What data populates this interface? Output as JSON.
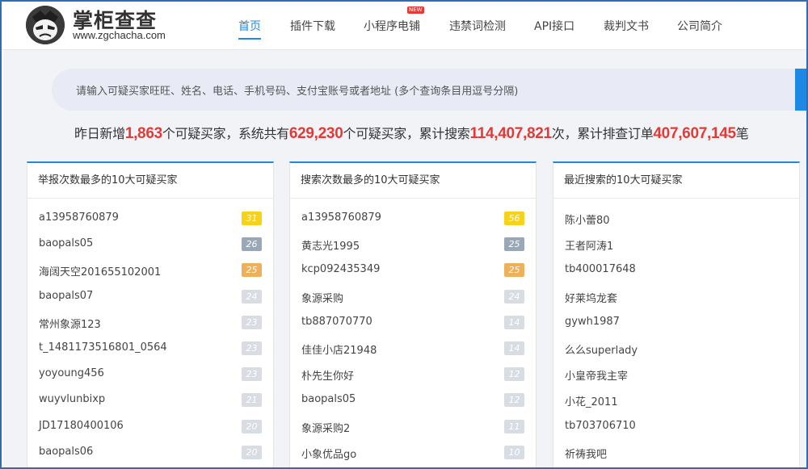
{
  "header": {
    "brand_name": "掌柜查查",
    "brand_url": "www.zgchacha.com",
    "logo_icon": "mascot-face-icon",
    "nav": [
      {
        "label": "首页",
        "active": true
      },
      {
        "label": "插件下载",
        "active": false
      },
      {
        "label": "小程序电铺",
        "active": false,
        "badge": "NEW"
      },
      {
        "label": "违禁词检测",
        "active": false
      },
      {
        "label": "API接口",
        "active": false
      },
      {
        "label": "裁判文书",
        "active": false
      },
      {
        "label": "公司简介",
        "active": false
      }
    ]
  },
  "search": {
    "placeholder": "请输入可疑买家旺旺、姓名、电话、手机号码、支付宝账号或者地址 (多个查询条目用逗号分隔)"
  },
  "stats": {
    "t1": "昨日新增",
    "n1": "1,863",
    "t2": "个可疑买家，系统共有",
    "n2": "629,230",
    "t3": "个可疑买家，累计搜索",
    "n3": "114,407,821",
    "t4": "次，累计排查订单",
    "n4": "407,607,145",
    "t5": "笔"
  },
  "panels": [
    {
      "title": "举报次数最多的10大可疑买家",
      "rows": [
        {
          "name": "a13958760879",
          "count": "31"
        },
        {
          "name": "baopals05",
          "count": "26"
        },
        {
          "name": "海阔天空201655102001",
          "count": "25"
        },
        {
          "name": "baopals07",
          "count": "24"
        },
        {
          "name": "常州象源123",
          "count": "23"
        },
        {
          "name": "t_1481173516801_0564",
          "count": "23"
        },
        {
          "name": "yoyoung456",
          "count": "23"
        },
        {
          "name": "wuyvlunbixp",
          "count": "21"
        },
        {
          "name": "JD17180400106",
          "count": "20"
        },
        {
          "name": "baopals06",
          "count": "20"
        }
      ]
    },
    {
      "title": "搜索次数最多的10大可疑买家",
      "rows": [
        {
          "name": "a13958760879",
          "count": "56"
        },
        {
          "name": "黄志光1995",
          "count": "25"
        },
        {
          "name": "kcp092435349",
          "count": "25"
        },
        {
          "name": "象源采购",
          "count": "24"
        },
        {
          "name": "tb887070770",
          "count": "14"
        },
        {
          "name": "佳佳小店21948",
          "count": "14"
        },
        {
          "name": "朴先生你好",
          "count": "12"
        },
        {
          "name": "baopals05",
          "count": "12"
        },
        {
          "name": "象源采购2",
          "count": "11"
        },
        {
          "name": "小象优品go",
          "count": "10"
        }
      ]
    },
    {
      "title": "最近搜索的10大可疑买家",
      "rows": [
        {
          "name": "陈小蕾80"
        },
        {
          "name": "王者阿涛1"
        },
        {
          "name": "tb400017648"
        },
        {
          "name": "好莱坞龙套"
        },
        {
          "name": "gywh1987"
        },
        {
          "name": "么么superlady"
        },
        {
          "name": "小皇帝我主宰"
        },
        {
          "name": "小花_2011"
        },
        {
          "name": "tb703706710"
        },
        {
          "name": "祈祷我吧"
        }
      ]
    }
  ],
  "colors": {
    "accent": "#1e88e5",
    "highlight_number": "#e53935",
    "rank1_badge": "#f7d21a",
    "rank2_badge": "#9aa7b7",
    "rank3_badge": "#eeb05a",
    "other_badge": "#d8dde4"
  }
}
